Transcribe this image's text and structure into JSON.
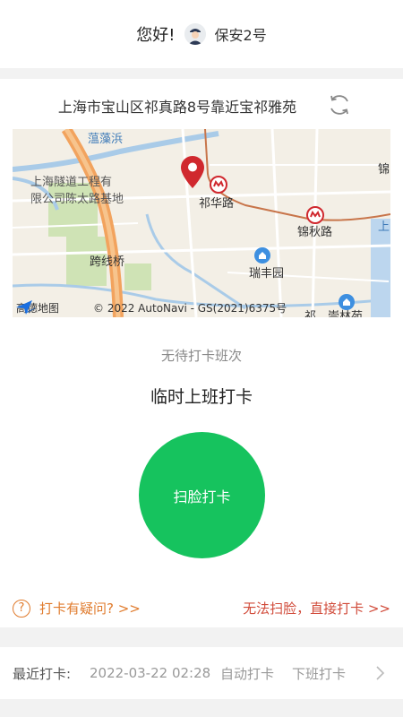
{
  "header": {
    "greeting": "您好!",
    "username": "保安2号",
    "avatar_icon": "security-guard-avatar"
  },
  "location": {
    "address": "上海市宝山区祁真路8号靠近宝祁雅苑",
    "refresh_icon": "refresh-icon"
  },
  "map": {
    "labels": {
      "river": "蕰藻浜",
      "company": "上海隧道工程有",
      "company2": "限公司陈太路基地",
      "station1": "祁华路",
      "station2": "锦秋路",
      "bridge": "跨线桥",
      "garden": "瑞丰园",
      "edge_right": "锦",
      "edge_right2": "上",
      "edge_bottom": "祁",
      "edge_bottom2": "崇林苑"
    },
    "brand": "高德地图",
    "copyright": "© 2022 AutoNavi - GS(2021)6375号"
  },
  "status": {
    "no_shift": "无待打卡班次",
    "temp_title": "临时上班打卡"
  },
  "scan_button": "扫脸打卡",
  "help": {
    "question": "打卡有疑问? >>",
    "direct": "无法扫脸，直接打卡 >>"
  },
  "recent": {
    "label": "最近打卡:",
    "time": "2022-03-22 02:28",
    "mode": "自动打卡",
    "type": "下班打卡"
  },
  "colors": {
    "primary_green": "#16c35e",
    "orange": "#e07b2d",
    "red": "#d14b3a"
  }
}
